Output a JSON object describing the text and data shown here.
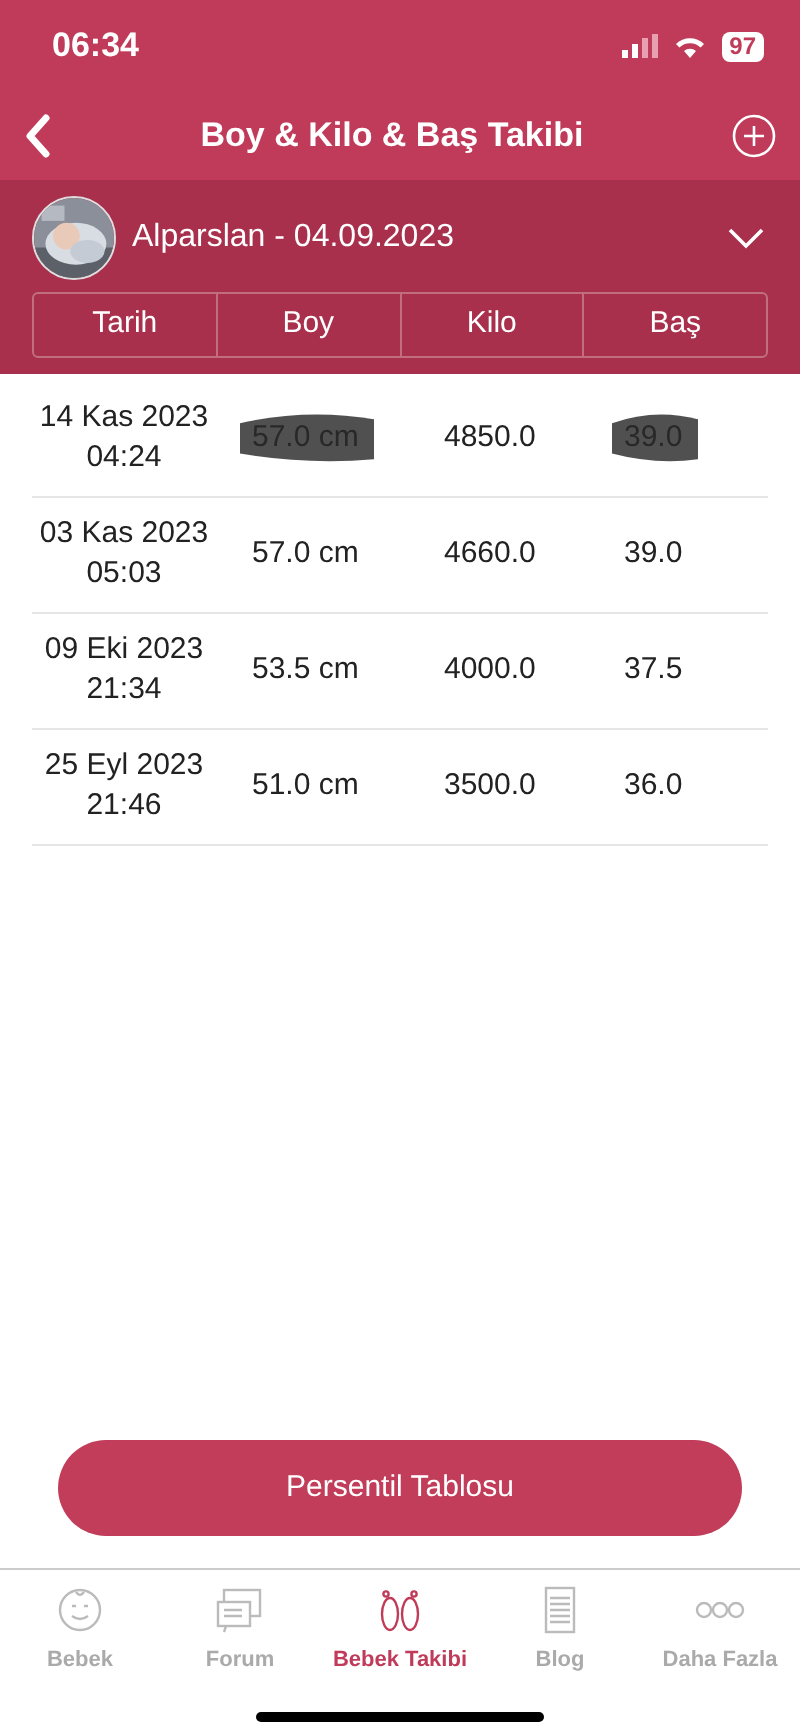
{
  "status_bar": {
    "time": "06:34",
    "battery": "97"
  },
  "nav": {
    "title": "Boy & Kilo & Baş Takibi"
  },
  "profile": {
    "name": "Alparslan - 04.09.2023",
    "expanded": false
  },
  "table": {
    "columns": [
      "Tarih",
      "Boy",
      "Kilo",
      "Baş"
    ],
    "rows": [
      {
        "date": "14 Kas 2023",
        "time": "04:24",
        "boy": "57.0 cm",
        "kilo": "4850.0",
        "bas": "39.0",
        "scribbled": true
      },
      {
        "date": "03 Kas 2023",
        "time": "05:03",
        "boy": "57.0 cm",
        "kilo": "4660.0",
        "bas": "39.0",
        "scribbled": false
      },
      {
        "date": "09 Eki 2023",
        "time": "21:34",
        "boy": "53.5 cm",
        "kilo": "4000.0",
        "bas": "37.5",
        "scribbled": false
      },
      {
        "date": "25 Eyl 2023",
        "time": "21:46",
        "boy": "51.0 cm",
        "kilo": "3500.0",
        "bas": "36.0",
        "scribbled": false
      }
    ]
  },
  "action_button": "Persentil Tablosu",
  "tab_bar": [
    {
      "label": "Bebek",
      "kind": "baby",
      "selected": false
    },
    {
      "label": "Forum",
      "kind": "forum",
      "selected": false
    },
    {
      "label": "Bebek Takibi",
      "kind": "feet",
      "selected": true
    },
    {
      "label": "Blog",
      "kind": "blog",
      "selected": false
    },
    {
      "label": "Daha Fazla",
      "kind": "more",
      "selected": false
    }
  ]
}
